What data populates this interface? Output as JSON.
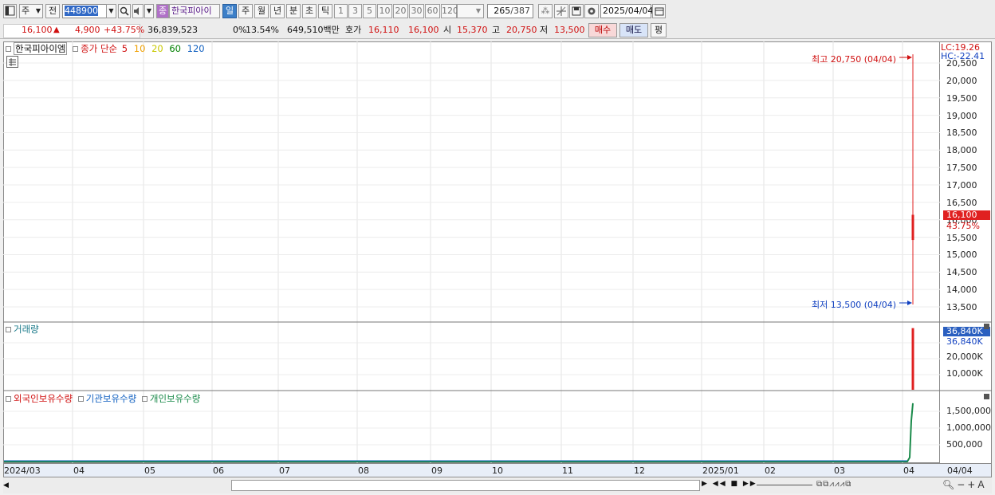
{
  "toolbar": {
    "market": "주",
    "prefix": "전",
    "code": "448900",
    "badge": "종",
    "stock_name": "한국피아이",
    "periods": [
      "일",
      "주",
      "월",
      "년",
      "분",
      "초",
      "틱"
    ],
    "minutes": [
      "1",
      "3",
      "5",
      "10",
      "20",
      "30",
      "60",
      "120"
    ],
    "count": "265",
    "total": "/387",
    "date": "2025/04/04"
  },
  "quote": {
    "price": "16,100",
    "change": "4,900",
    "change_pct": "+43.75%",
    "volume": "36,839,523",
    "ratio": "0%",
    "turnover": "13.54%",
    "amount": "649,510백만",
    "bid_label": "호가",
    "bid1": "16,110",
    "bid2": "16,100",
    "open_label": "시",
    "open": "15,370",
    "high_label": "고",
    "high": "20,750",
    "low_label": "저",
    "low": "13,500",
    "buy_label": "매수",
    "sell_label": "매도",
    "avg_label": "평"
  },
  "price_pane": {
    "legend_name": "한국피아이엠",
    "legend_ma": "종가 단순",
    "ma": [
      "5",
      "10",
      "20",
      "60",
      "120"
    ],
    "ma_colors": [
      "#d01010",
      "#f0a000",
      "#c8c800",
      "#008000",
      "#1060c0"
    ],
    "lc": "LC:19.26",
    "hc": "HC:-22.41",
    "high_annot": "최고 20,750 (04/04)",
    "low_annot": "최저 13,500 (04/04)",
    "last_price": "16,100",
    "last_pct": "43.75%",
    "y_ticks": [
      "20,500",
      "20,000",
      "19,500",
      "19,000",
      "18,500",
      "18,000",
      "17,500",
      "17,000",
      "16,500",
      "16,000",
      "15,500",
      "15,000",
      "14,500",
      "14,000",
      "13,500"
    ]
  },
  "volume_pane": {
    "title": "거래량",
    "last": "36,840K",
    "last2": "36,840K",
    "y_ticks": [
      "20,000K",
      "10,000K"
    ]
  },
  "holdings_pane": {
    "series": [
      "외국인보유수량",
      "기관보유수량",
      "개인보유수량"
    ],
    "series_colors": [
      "#d01010",
      "#1060c0",
      "#1a8a4a"
    ],
    "y_ticks": [
      "1,500,000",
      "1,000,000",
      "500,000"
    ]
  },
  "x_axis": [
    "2024/03",
    "04",
    "05",
    "06",
    "07",
    "08",
    "09",
    "10",
    "11",
    "12",
    "2025/01",
    "02",
    "03",
    "04"
  ],
  "x_last": "04/04",
  "chart_data": {
    "type": "candlestick",
    "x": [
      "2025/04/04"
    ],
    "open": [
      15370
    ],
    "high": [
      20750
    ],
    "low": [
      13500
    ],
    "close": [
      16100
    ],
    "volume": [
      36839523
    ],
    "ylim": [
      13500,
      20500
    ],
    "holdings": {
      "개인보유수량": [
        1700000
      ]
    }
  }
}
